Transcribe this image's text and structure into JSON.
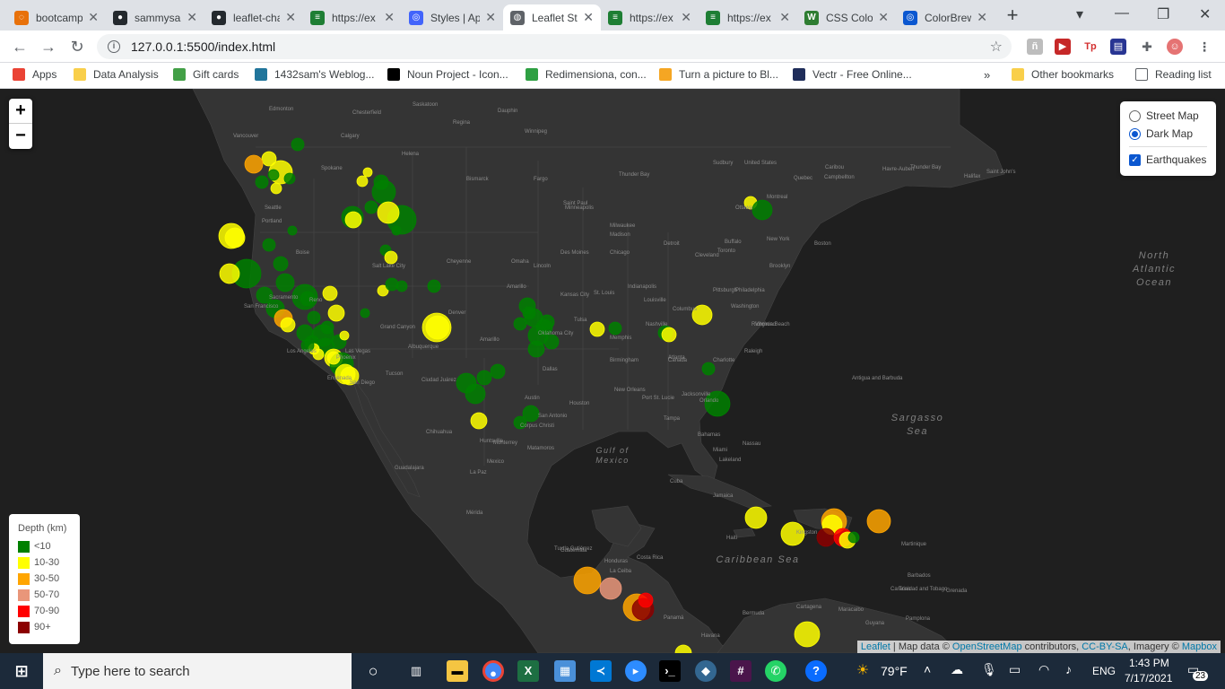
{
  "tabs": [
    {
      "title": "bootcamp",
      "color": "#e8710a",
      "glyph": "◌"
    },
    {
      "title": "sammysam",
      "color": "#24292e",
      "glyph": "●"
    },
    {
      "title": "leaflet-challenge",
      "color": "#24292e",
      "glyph": "●"
    },
    {
      "title": "https://ex",
      "color": "#1e7e34",
      "glyph": "≡"
    },
    {
      "title": "Styles | Api",
      "color": "#4264fb",
      "glyph": "◎"
    },
    {
      "title": "Leaflet Step",
      "color": "#5f6368",
      "glyph": "◍"
    },
    {
      "title": "https://ex",
      "color": "#1e7e34",
      "glyph": "≡"
    },
    {
      "title": "https://ex",
      "color": "#1e7e34",
      "glyph": "≡"
    },
    {
      "title": "CSS Colors",
      "color": "#2e7d32",
      "glyph": "W"
    },
    {
      "title": "ColorBrewer",
      "color": "#0b57d0",
      "glyph": "◎"
    }
  ],
  "address": {
    "url": "127.0.0.1:5500/index.html"
  },
  "bookmarks": [
    {
      "label": "Apps",
      "color": "#ea4335"
    },
    {
      "label": "Data Analysis",
      "color": "#f9cf4a"
    },
    {
      "label": "Gift cards",
      "color": "#43a047"
    },
    {
      "label": "1432sam's Weblog...",
      "color": "#21759b"
    },
    {
      "label": "Noun Project - Icon...",
      "color": "#000000"
    },
    {
      "label": "Redimensiona, con...",
      "color": "#2ea043"
    },
    {
      "label": "Turn a picture to Bl...",
      "color": "#f5a623"
    },
    {
      "label": "Vectr - Free Online...",
      "color": "#1f2d5a"
    }
  ],
  "bookmarks_right": {
    "more": "»",
    "other": "Other bookmarks",
    "reading": "Reading list"
  },
  "zoom": {
    "in": "+",
    "out": "−"
  },
  "layers": {
    "base": [
      "Street Map",
      "Dark Map"
    ],
    "selected": "Dark Map",
    "overlay": "Earthquakes"
  },
  "legend": {
    "title": "Depth (km)",
    "items": [
      {
        "label": "<10",
        "color": "#008000"
      },
      {
        "label": "10-30",
        "color": "#ffff00"
      },
      {
        "label": "30-50",
        "color": "#ffa500"
      },
      {
        "label": "50-70",
        "color": "#e9967a"
      },
      {
        "label": "70-90",
        "color": "#ff0000"
      },
      {
        "label": "90+",
        "color": "#8b0000"
      }
    ]
  },
  "attribution": {
    "leaflet": "Leaflet",
    "mapdata": " | Map data © ",
    "osm": "OpenStreetMap",
    "contrib": " contributors, ",
    "license": "CC-BY-SA",
    "imagery": ", Imagery © ",
    "mapbox": "Mapbox"
  },
  "oceans": {
    "north_atlantic": "North Atlantic Ocean",
    "sargasso": "Sargasso Sea",
    "gulf": "Gulf of Mexico",
    "caribbean": "Caribbean Sea"
  },
  "places": [
    "Chesterfield",
    "Regina",
    "Winnipeg",
    "Dauphin",
    "Edmonton",
    "Saskatoon",
    "Calgary",
    "Vancouver",
    "Seattle",
    "Portland",
    "Spokane",
    "Helena",
    "Boise",
    "Salt Lake City",
    "Fargo",
    "Bismarck",
    "Thunder Bay",
    "Sudbury",
    "Ottawa",
    "Montreal",
    "Quebec",
    "Toronto",
    "Detroit",
    "Chicago",
    "Cleveland",
    "Buffalo",
    "Boston",
    "New York",
    "Brooklyn",
    "Minneapolis",
    "Saint Paul",
    "Milwaukee",
    "Madison",
    "Des Moines",
    "Omaha",
    "Denver",
    "Cheyenne",
    "Lincoln",
    "Kansas City",
    "St. Louis",
    "Louisville",
    "Indianapolis",
    "Columbus",
    "Pittsburgh",
    "Philadelphia",
    "Washington",
    "Richmond",
    "Virginia Beach",
    "Raleigh",
    "Charlotte",
    "Atlanta",
    "Birmingham",
    "Memphis",
    "Nashville",
    "Jacksonville",
    "Orlando",
    "Tampa",
    "Miami",
    "New Orleans",
    "Houston",
    "Dallas",
    "Austin",
    "San Antonio",
    "Corpus Christi",
    "Oklahoma City",
    "Tulsa",
    "Amarillo",
    "Albuquerque",
    "Phoenix",
    "Tucson",
    "Las Vegas",
    "Los Angeles",
    "San Diego",
    "San Francisco",
    "Sacramento",
    "Reno",
    "Grand Canyon",
    "Ensenada",
    "Ciudad Juárez",
    "Chihuahua",
    "Monterrey",
    "Matamoros",
    "Mexico",
    "La Paz",
    "Guadalajara",
    "Mérida",
    "Tuxtla Gutiérrez",
    "Guatemala",
    "Honduras",
    "La Ceiba",
    "Costa Rica",
    "Panamá",
    "Havana",
    "Cuba",
    "Jamaica",
    "Haiti",
    "Kingston",
    "Caracas",
    "Maracaibo",
    "Cartagena",
    "Bermuda",
    "Antigua and Barbuda",
    "Martinique",
    "Barbados",
    "Grenada",
    "Trinidad and Tobago",
    "Pamplona",
    "Guyana",
    "Saint John's",
    "Halifax",
    "Havre-Aubert",
    "Campbellton",
    "Caribou",
    "Thunder Bay",
    "Lakeland",
    "Nassau",
    "Bahamas",
    "Port St. Lucie",
    "Huntsville",
    "Amarillo",
    "United States",
    "Canada",
    "Atlanta"
  ],
  "taskbar": {
    "search_placeholder": "Type here to search",
    "weather": "79°F",
    "lang": "ENG",
    "time": "1:43 PM",
    "date": "7/17/2021",
    "notif": "23"
  }
}
